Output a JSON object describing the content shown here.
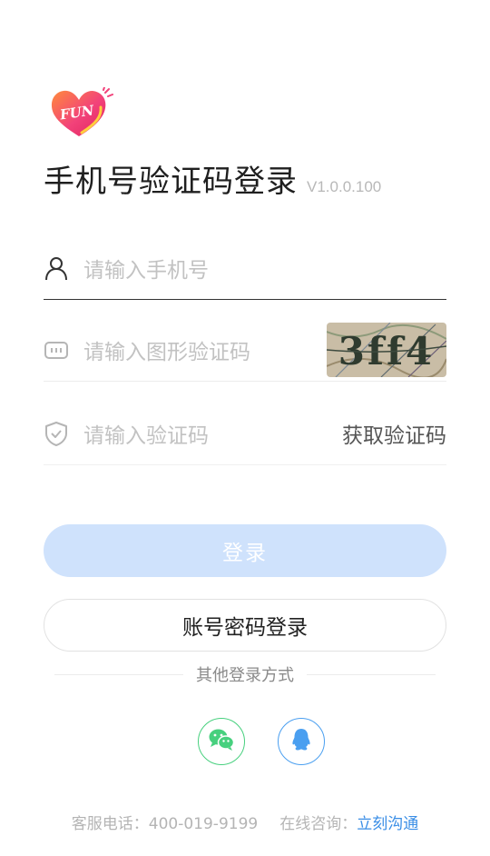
{
  "brand": {
    "logo_text": "FUN"
  },
  "header": {
    "title": "手机号验证码登录",
    "version": "V1.0.0.100"
  },
  "form": {
    "phone_placeholder": "请输入手机号",
    "captcha_placeholder": "请输入图形验证码",
    "captcha_text": "3ff4",
    "sms_placeholder": "请输入验证码",
    "get_code_label": "获取验证码"
  },
  "buttons": {
    "login_label": "登录",
    "password_login_label": "账号密码登录"
  },
  "other_login": {
    "label": "其他登录方式",
    "methods": [
      "wechat-icon",
      "qq-icon"
    ]
  },
  "footer": {
    "phone_label": "客服电话：",
    "phone_number": "400-019-9199",
    "consult_label": "在线咨询：",
    "consult_link": "立刻沟通"
  },
  "colors": {
    "accent": "#3a8ee6",
    "login_disabled": "#cfe2fc",
    "wechat": "#47d07e",
    "qq": "#4a9ff0"
  }
}
